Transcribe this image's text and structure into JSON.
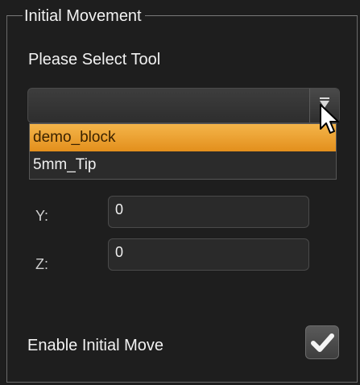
{
  "group": {
    "title": "Initial Movement"
  },
  "tool": {
    "prompt": "Please Select Tool",
    "selected_value": "",
    "options": [
      {
        "label": "demo_block",
        "highlighted": true
      },
      {
        "label": "5mm_Tip",
        "highlighted": false
      }
    ]
  },
  "fields": {
    "y": {
      "label": "Y:",
      "value": "0"
    },
    "z": {
      "label": "Z:",
      "value": "0"
    }
  },
  "enable": {
    "label": "Enable Initial Move",
    "checked": true
  },
  "colors": {
    "highlight": "#f0a030",
    "background": "#1e1e1e"
  }
}
